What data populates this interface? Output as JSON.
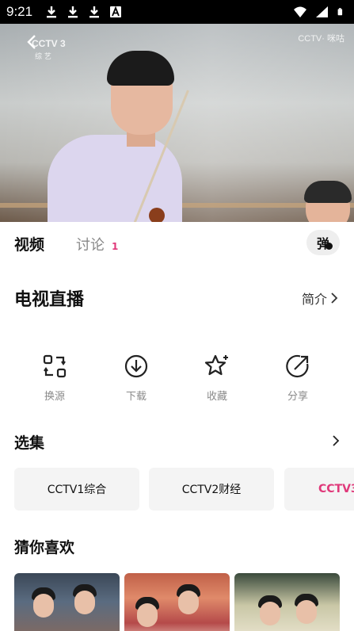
{
  "status_bar": {
    "time": "9:21",
    "left_icons": [
      "download-icon",
      "download-icon",
      "download-icon",
      "font-a-icon"
    ],
    "right_icons": [
      "wifi-icon",
      "signal-icon",
      "battery-icon"
    ]
  },
  "video": {
    "channel_logo": "CCTV 3",
    "channel_sub": "综 艺",
    "watermark": "CCTV· 咪咕"
  },
  "tabs": {
    "video_label": "视频",
    "discuss_label": "讨论",
    "discuss_count": "1",
    "danmaku_label": "弹"
  },
  "header": {
    "title": "电视直播",
    "intro_label": "简介"
  },
  "actions": [
    {
      "label": "换源",
      "icon": "switch-source-icon"
    },
    {
      "label": "下载",
      "icon": "download-icon"
    },
    {
      "label": "收藏",
      "icon": "star-icon"
    },
    {
      "label": "分享",
      "icon": "share-icon"
    }
  ],
  "episodes": {
    "title": "选集",
    "items": [
      "CCTV1综合",
      "CCTV2财经",
      "CCTV3"
    ],
    "active_index": 2,
    "accent_color": "#e0397a"
  },
  "recommend": {
    "title": "猜你喜欢"
  }
}
